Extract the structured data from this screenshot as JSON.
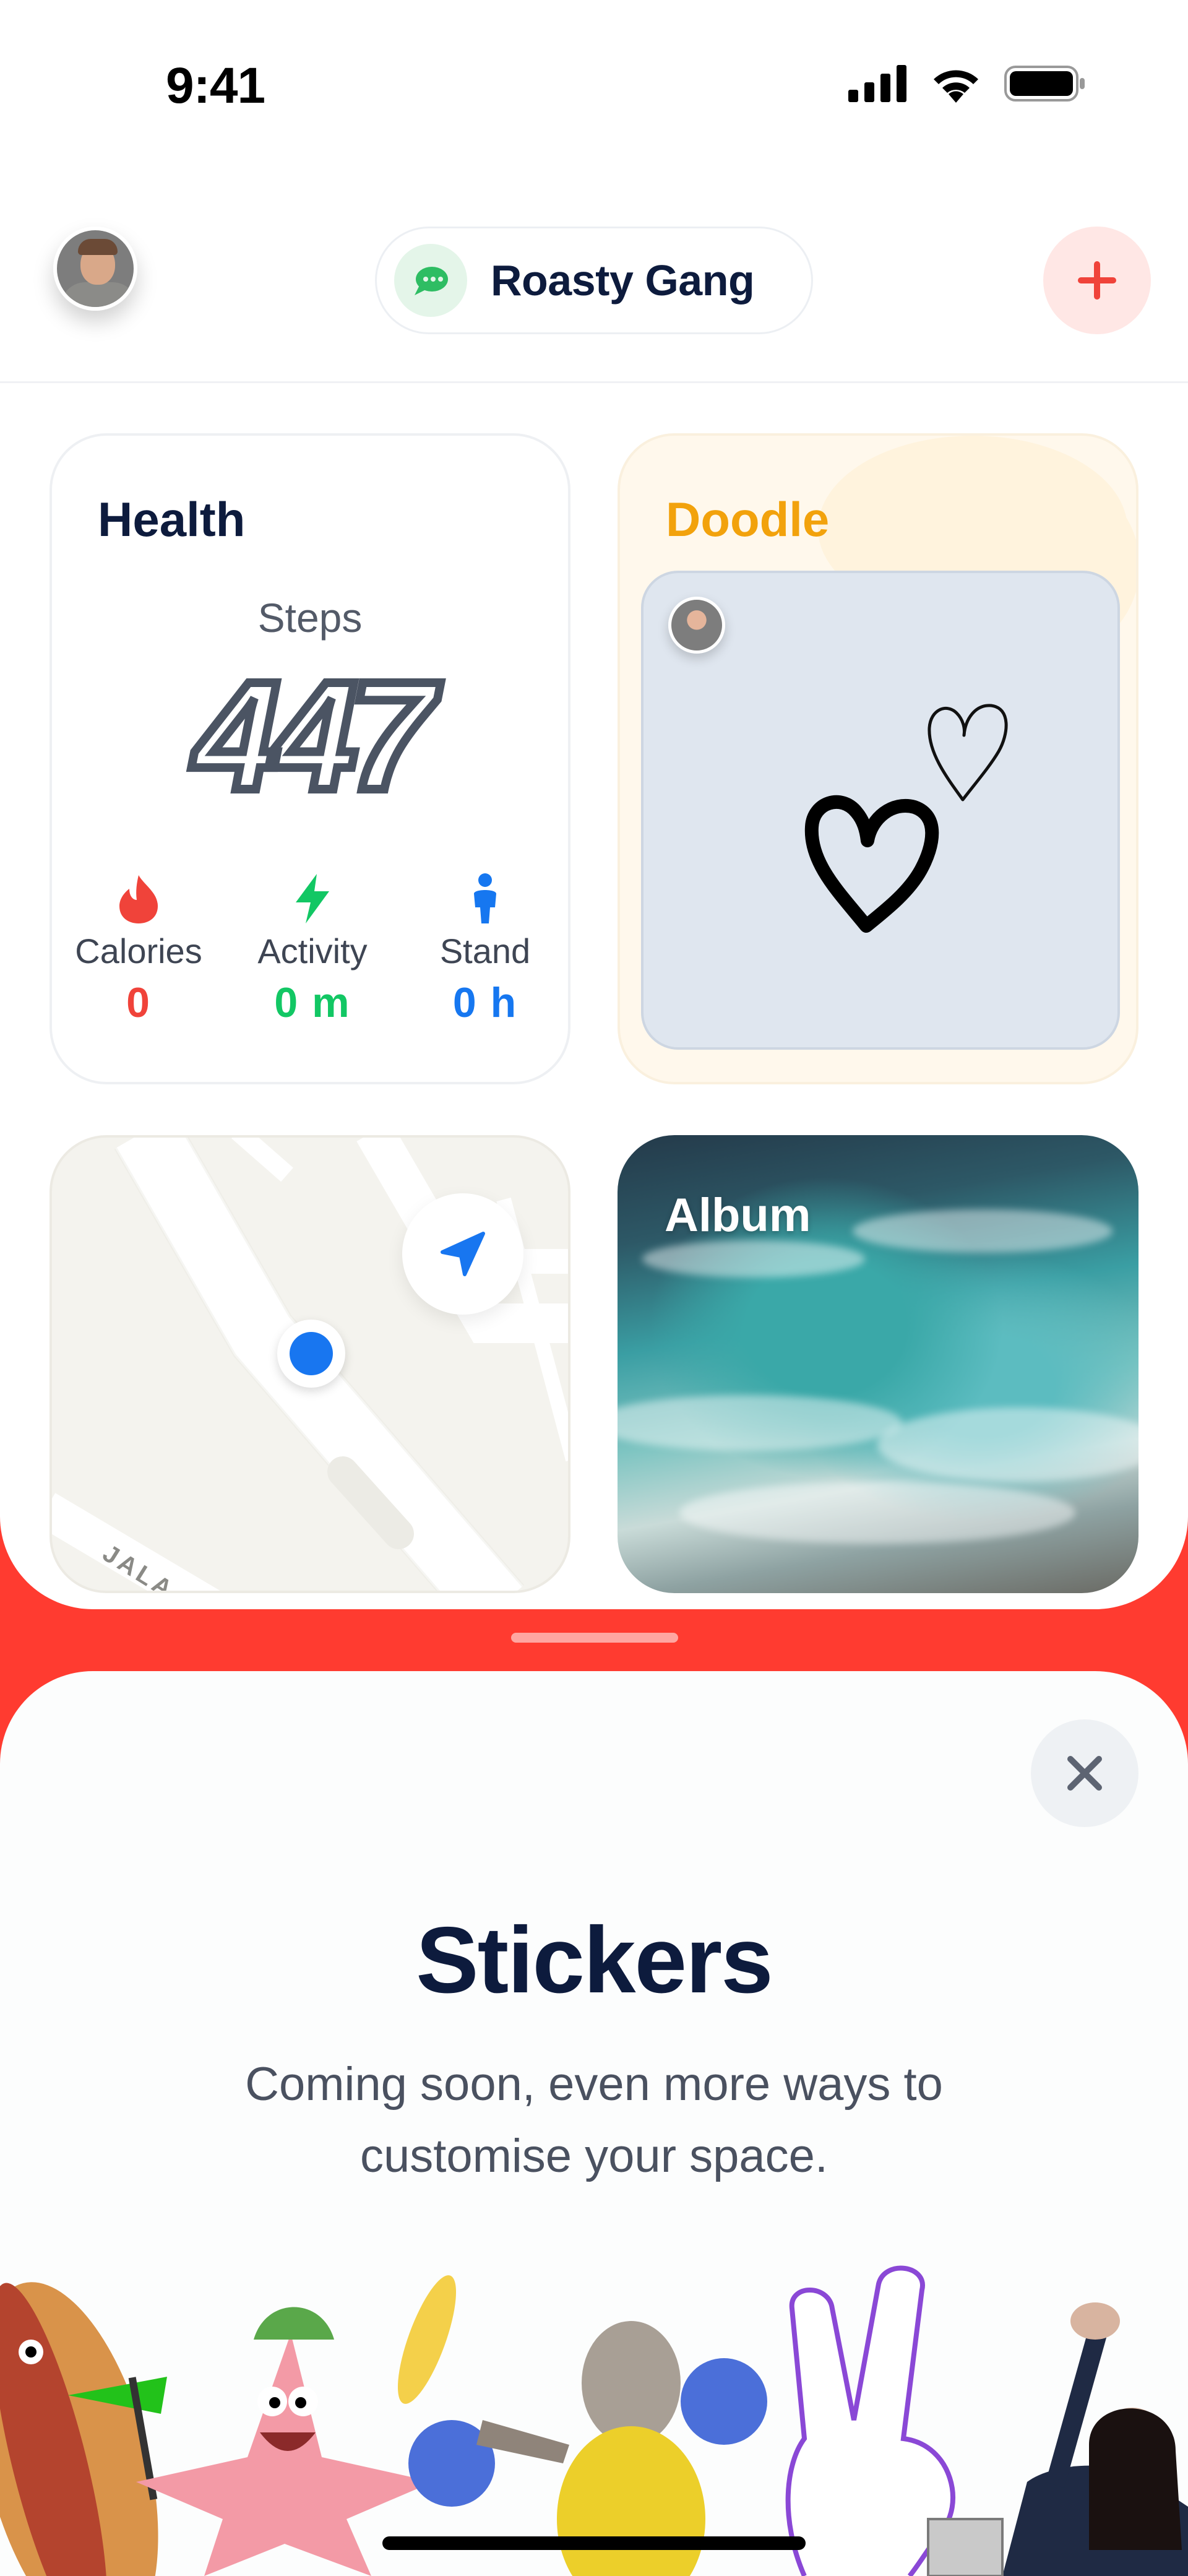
{
  "status_bar": {
    "time": "9:41"
  },
  "header": {
    "group_name": "Roasty Gang",
    "add_label": "+"
  },
  "widgets": {
    "health": {
      "title": "Health",
      "steps_label": "Steps",
      "steps_value": "447",
      "metrics": [
        {
          "label": "Calories",
          "value": "0",
          "color": "#f0433a",
          "icon": "flame-icon"
        },
        {
          "label": "Activity",
          "value": "0 m",
          "color": "#12c764",
          "icon": "lightning-icon"
        },
        {
          "label": "Stand",
          "value": "0 h",
          "color": "#1677f0",
          "icon": "standing-person-icon"
        }
      ]
    },
    "doodle": {
      "title": "Doodle"
    },
    "map": {
      "street_label": "JALA"
    },
    "album": {
      "title": "Album"
    }
  },
  "sheet": {
    "close_label": "×",
    "title": "Stickers",
    "subtitle": "Coming soon, even more ways to customise your space."
  },
  "colors": {
    "accent_red": "#ff3b30",
    "navy": "#0d1b3d",
    "doodle_orange": "#f2a20c"
  }
}
